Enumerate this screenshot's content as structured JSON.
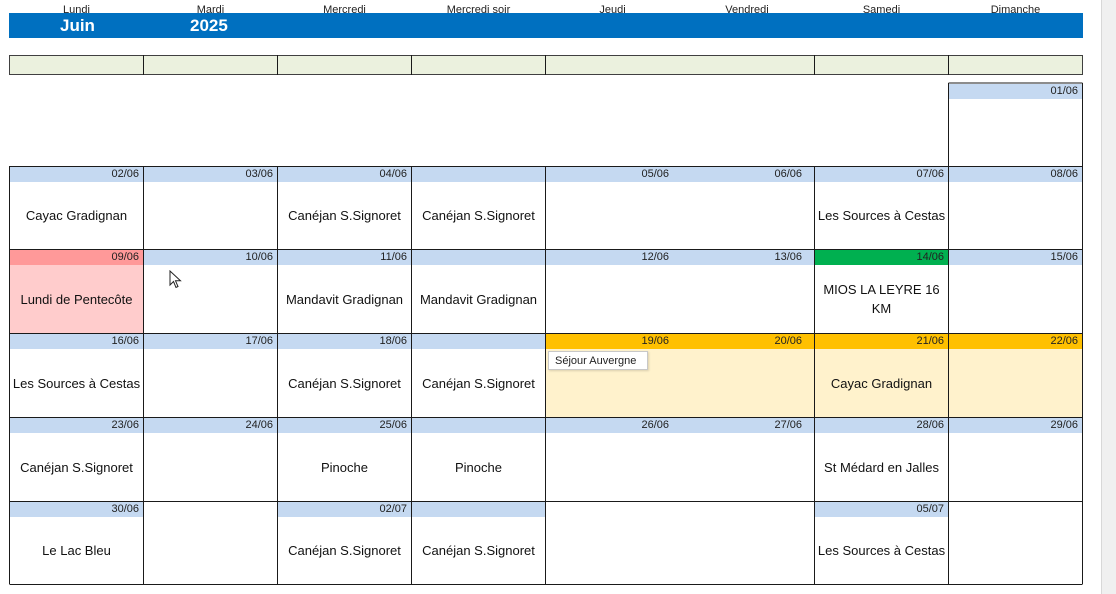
{
  "calendar": {
    "month": "Juin",
    "year": "2025",
    "days": [
      "Lundi",
      "Mardi",
      "Mercredi",
      "Mercredi soir",
      "Jeudi",
      "Vendredi",
      "Samedi",
      "Dimanche"
    ]
  },
  "colors": {
    "title_bar": "#0070c0",
    "day_header": "#ebf1de",
    "date_strip": "#c5d9f1",
    "holiday_strip": "#ff9999",
    "holiday_fill": "#ffcccc",
    "sejour_strip": "#ffc000",
    "sejour_fill": "#fff2cc",
    "race_strip": "#00b050"
  },
  "weeks": [
    {
      "dates": {
        "dim": "01/06"
      }
    },
    {
      "dates": {
        "lun": "02/06",
        "mar": "03/06",
        "mer": "04/06",
        "jeu": "05/06",
        "ven": "06/06",
        "sam": "07/06",
        "dim": "08/06"
      },
      "events": {
        "lun": "Cayac Gradignan",
        "mer": "Canéjan S.Signoret",
        "mer_soir": "Canéjan S.Signoret",
        "sam": "Les Sources à Cestas"
      }
    },
    {
      "dates": {
        "lun": "09/06",
        "mar": "10/06",
        "mer": "11/06",
        "jeu": "12/06",
        "ven": "13/06",
        "sam": "14/06",
        "dim": "15/06"
      },
      "events": {
        "lun": "Lundi de Pentecôte",
        "mer": "Mandavit Gradignan",
        "mer_soir": "Mandavit Gradignan",
        "sam": "MIOS LA LEYRE 16 KM"
      }
    },
    {
      "dates": {
        "lun": "16/06",
        "mar": "17/06",
        "mer": "18/06",
        "jeu": "19/06",
        "ven": "20/06",
        "sam": "21/06",
        "dim": "22/06"
      },
      "events": {
        "lun": "Les Sources à Cestas",
        "mer": "Canéjan S.Signoret",
        "mer_soir": "Canéjan S.Signoret",
        "sam": "Cayac Gradignan"
      },
      "popup": "Séjour Auvergne"
    },
    {
      "dates": {
        "lun": "23/06",
        "mar": "24/06",
        "mer": "25/06",
        "jeu": "26/06",
        "ven": "27/06",
        "sam": "28/06",
        "dim": "29/06"
      },
      "events": {
        "lun": "Canéjan S.Signoret",
        "mer": "Pinoche",
        "mer_soir": "Pinoche",
        "sam": "St Médard en Jalles"
      }
    },
    {
      "dates": {
        "lun": "30/06",
        "mer": "02/07",
        "sam": "05/07"
      },
      "events": {
        "lun": "Le Lac Bleu",
        "mer": "Canéjan S.Signoret",
        "mer_soir": "Canéjan S.Signoret",
        "sam": "Les Sources à Cestas"
      }
    }
  ]
}
